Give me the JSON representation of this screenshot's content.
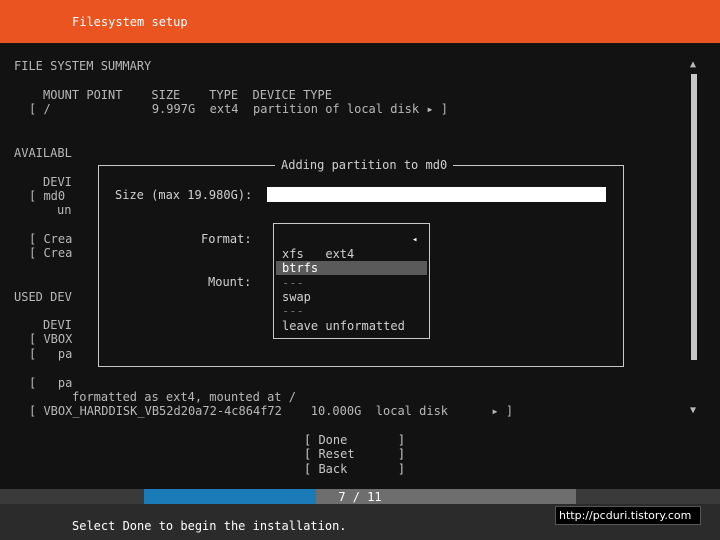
{
  "header": {
    "title": "Filesystem setup"
  },
  "summary": {
    "heading": "FILE SYSTEM SUMMARY",
    "columns": "MOUNT POINT    SIZE    TYPE  DEVICE TYPE",
    "row": "[ /              9.997G  ext4  partition of local disk ▸ ]"
  },
  "available": {
    "heading": "AVAILABL",
    "col": "DEVI",
    "device": "[ md0",
    "device_sub": "un",
    "create1": "[ Crea",
    "create2": "[ Crea"
  },
  "used": {
    "heading": "USED DEV",
    "col": "DEVI",
    "device": "[ VBOX",
    "part1": "[   pa",
    "part2": "[   pa",
    "formatted": "formatted as ext4, mounted at /",
    "disk_row": "[ VBOX_HARDDISK_VB52d20a72-4c864f72    10.000G  local disk      ▸ ]"
  },
  "dialog": {
    "title": "Adding partition to md0",
    "size_label": "Size (max 19.980G):",
    "size_value": "",
    "format_label": "Format:",
    "mount_label": "Mount:",
    "format_options": [
      {
        "label": "ext4",
        "current": true
      },
      {
        "label": "xfs"
      },
      {
        "label": "btrfs",
        "highlighted": true
      },
      {
        "label": "---",
        "separator": true
      },
      {
        "label": "swap"
      },
      {
        "label": "---",
        "separator": true
      },
      {
        "label": "leave unformatted"
      }
    ],
    "current_marker": "◂"
  },
  "actions": {
    "done": "[ Done       ]",
    "reset": "[ Reset      ]",
    "back": "[ Back       ]"
  },
  "progress": {
    "text": "7 / 11",
    "current": 7,
    "total": 11
  },
  "footer": {
    "status": "Select Done to begin the installation."
  },
  "watermark": "http://pcduri.tistory.com",
  "scroll": {
    "up": "▲",
    "down": "▼"
  },
  "colors": {
    "header": "#e95420",
    "progress": "#1a7bb8",
    "background": "#121212"
  }
}
